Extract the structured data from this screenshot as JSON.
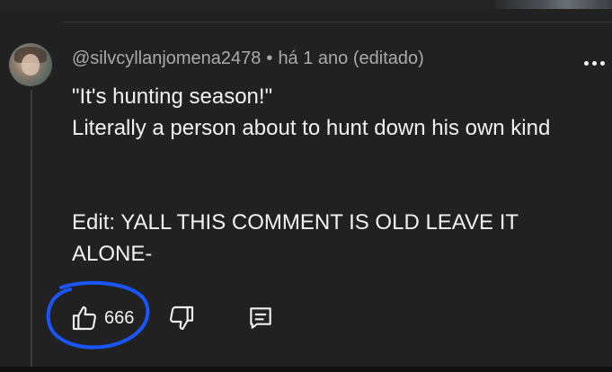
{
  "comment": {
    "author": "@silvcyllanjomena2478",
    "separator": "•",
    "timestamp": "há 1 ano (editado)",
    "lines": [
      "\"It's hunting season!\"",
      "Literally a person about to hunt down his own kind"
    ],
    "edit_lines": [
      "Edit: YALL THIS COMMENT IS OLD LEAVE IT",
      "ALONE-"
    ],
    "like_count": "666"
  },
  "icons": {
    "avatar": "avatar",
    "more": "more-vertical-icon",
    "like": "thumbs-up-icon",
    "dislike": "thumbs-down-icon",
    "reply": "reply-icon"
  },
  "colors": {
    "background": "#212121",
    "text": "#f1f1f1",
    "meta_text": "#aaaaaa",
    "annotation_circle": "#1a56ff"
  }
}
